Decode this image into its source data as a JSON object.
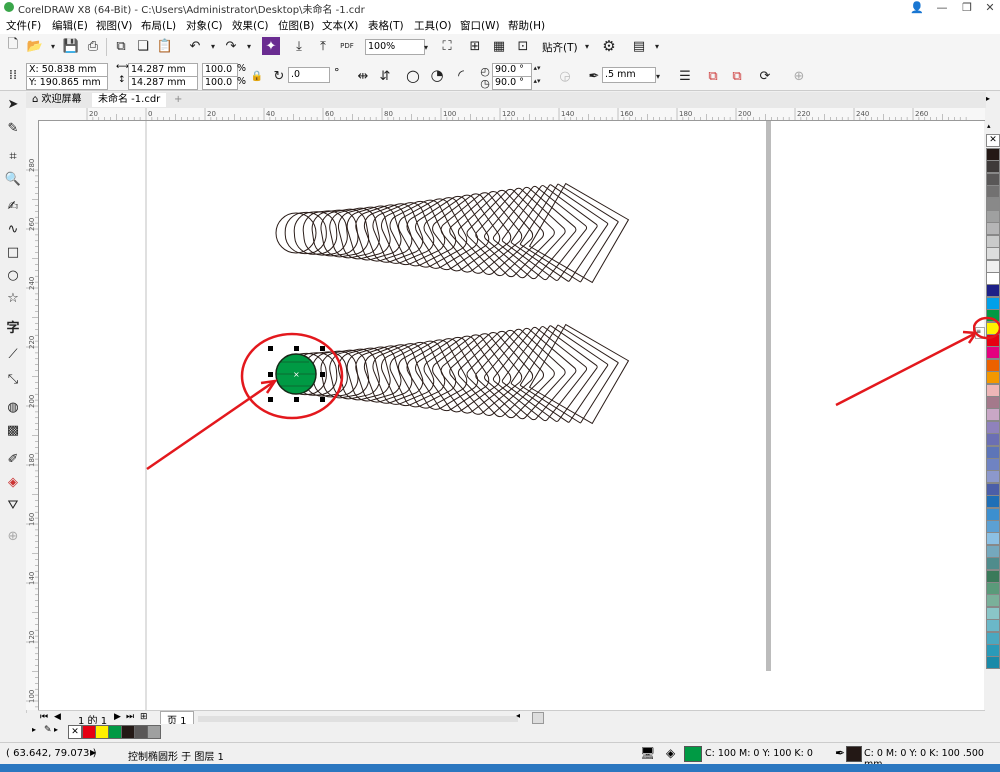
{
  "window": {
    "title": "CorelDRAW X8 (64-Bit) - C:\\Users\\Administrator\\Desktop\\未命名 -1.cdr"
  },
  "menu": [
    "文件(F)",
    "编辑(E)",
    "视图(V)",
    "布局(L)",
    "对象(C)",
    "效果(C)",
    "位图(B)",
    "文本(X)",
    "表格(T)",
    "工具(O)",
    "窗口(W)",
    "帮助(H)"
  ],
  "standard_toolbar": {
    "zoom": "100%",
    "snap_label": "贴齐(T)",
    "pdf_label": "PDF"
  },
  "property_bar": {
    "x": "X: 50.838 mm",
    "y": "Y: 190.865 mm",
    "width": "14.287 mm",
    "height": "14.287 mm",
    "scale_w": "100.0",
    "scale_h": "100.0",
    "percent": "%",
    "angle": ".0",
    "deg": "°",
    "start_angle": "90.0 °",
    "end_angle": "90.0 °",
    "outline_width": ".5 mm"
  },
  "tabs": {
    "welcome": "欢迎屏幕",
    "document": "未命名 -1.cdr"
  },
  "ruler": {
    "h_labels": [
      "20",
      "0",
      "20",
      "40",
      "60",
      "80",
      "100",
      "120",
      "140",
      "160",
      "180",
      "200",
      "220",
      "240",
      "260"
    ],
    "v_labels": [
      "280",
      "260",
      "240",
      "220",
      "200",
      "180",
      "160",
      "140",
      "120",
      "100"
    ]
  },
  "pages": {
    "current": "1 的 1",
    "page_tab": "页 1"
  },
  "status": {
    "coords": "( 63.642, 79.073 )",
    "info": "控制椭圆形 于 图层 1",
    "fill": "C: 100 M: 0 Y: 100 K: 0",
    "outline": "C: 0 M: 0 Y: 0 K: 100 .500 mm"
  },
  "colors": {
    "fill_green": "#009a44",
    "annotation_red": "#e3181d",
    "stroke_dark": "#2a1c18",
    "page_shadow": "#bcbcbc"
  },
  "palette": [
    "#231815",
    "#3e3a39",
    "#595757",
    "#727171",
    "#898989",
    "#9fa0a0",
    "#b5b5b6",
    "#c9caca",
    "#dcdddd",
    "#efefef",
    "#ffffff",
    "#1d2088",
    "#00a0e9",
    "#009944",
    "#fff100",
    "#e60012",
    "#e4007f",
    "#eb6100",
    "#f39800",
    "#eeb6b7",
    "#a4798b",
    "#c9a7c6",
    "#8f82bc",
    "#6b6fb3",
    "#5d75b8",
    "#6f83c2",
    "#8c98cc",
    "#4b5ea8",
    "#1f6fb6",
    "#3c8fcf",
    "#5ca0d3",
    "#8cc0e3",
    "#75a8bd",
    "#4f8c8c",
    "#3a7a5a",
    "#5a9a7a",
    "#7ab09a",
    "#8ac6c8",
    "#6bb8c8",
    "#4aa8c0",
    "#2a9ab8",
    "#1a8aa8"
  ],
  "doc_palette": [
    "#e60012",
    "#fff100",
    "#009944",
    "#231815",
    "#595757",
    "#9fa0a0"
  ]
}
